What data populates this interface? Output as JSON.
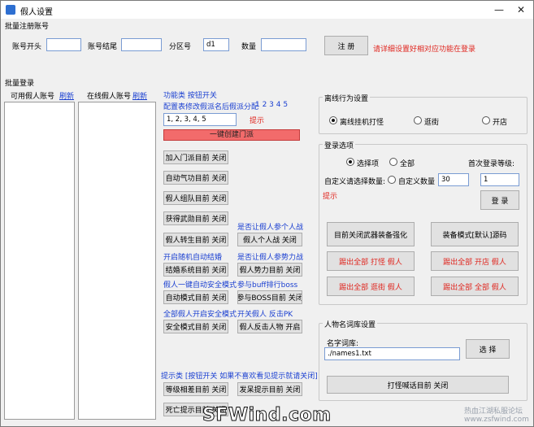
{
  "window": {
    "title": "假人设置",
    "minimize": "—",
    "close": "✕"
  },
  "batch_register": {
    "section_label": "批量注册账号",
    "account_start_label": "账号开头",
    "account_start_value": "",
    "account_end_label": "账号结尾",
    "account_end_value": "",
    "zone_label": "分区号",
    "zone_value": "d1",
    "count_label": "数量",
    "count_value": "",
    "register_button": "注 册",
    "hint": "请详细设置好相对应功能在登录"
  },
  "batch_login": {
    "section_label": "批量登录",
    "available_label": "可用假人账号",
    "available_refresh": "刷新",
    "online_label": "在线假人账号",
    "online_refresh": "刷新"
  },
  "functions": {
    "header": "功能类 按钮开关",
    "config_text": "配置表修改假派名后假派分配",
    "config_numbers": "1 2 3 4 5",
    "config_input": "1, 2, 3, 4, 5",
    "hint": "提示",
    "create_gate_button": "一键创建门派",
    "btn_join_gate": "加入门派目前 关闭",
    "btn_auto_qigong": "自动气功目前 关闭",
    "btn_fake_party": "假人组队目前 关闭",
    "btn_get_martial": "获得武勋目前 关闭",
    "btn_fake_rebirth": "假人转生目前 关闭",
    "label_join_battle": "是否让假人参个人战",
    "btn_personal_battle": "假人个人战 关闭",
    "label_random_marry": "开启随机自动结婚",
    "label_faction_battle": "是否让假人参势力战",
    "btn_marriage_system": "结婚系统目前 关闭",
    "btn_faction_battle": "假人势力目前 关闭",
    "label_auto_safe": "假人一键自动安全模式",
    "label_buff_rank": "参与buff排行boss",
    "btn_auto_mode": "自动模式目前 关闭",
    "btn_boss": "参与BOSS目前 关闭",
    "label_all_safe": "全部假人开启安全模式",
    "label_pk": "开关假人 反击PK",
    "btn_safe_mode": "安全模式目前 关闭",
    "btn_counter": "假人反击人物 开启",
    "tip_text": "提示类 [按钮开关 如果不喜欢看见提示就请关闭]",
    "btn_level_tip": "等级相差目前 关闭",
    "btn_outfit_tip": "发呆提示目前 关闭",
    "btn_death_tip": "死亡提示目前 关闭"
  },
  "offline": {
    "group_title": "离线行为设置",
    "options": [
      "离线挂机打怪",
      "逛街",
      "开店"
    ],
    "selected": 0
  },
  "login_options": {
    "group_title": "登录选项",
    "opt_select": "选择项",
    "opt_all": "全部",
    "first_level_label": "首次登录等级:",
    "first_level_value": "1",
    "custom_label": "自定义请选择数量:",
    "opt_custom": "自定义数量",
    "custom_value": "30",
    "hint": "提示",
    "login_button": "登 录",
    "btn_weapon_enhance": "目前关闭武器装备强化",
    "btn_equip_mode": "装备模式[默认]源码",
    "btn_kick_fight": "踢出全部 打怪 假人",
    "btn_kick_shop": "踢出全部 开店 假人",
    "btn_kick_street": "踢出全部 逛街 假人",
    "btn_kick_all": "踢出全部 全部 假人"
  },
  "name_dict": {
    "group_title": "人物名词库设置",
    "dict_label": "名字词库:",
    "dict_value": "./names1.txt",
    "select_button": "选 择",
    "shout_button": "打怪喊话目前 关闭"
  },
  "watermark": {
    "main": "SFWind.com",
    "side_line1": "热血江湖私服论坛",
    "side_line2": "www.zsfwind.com"
  }
}
